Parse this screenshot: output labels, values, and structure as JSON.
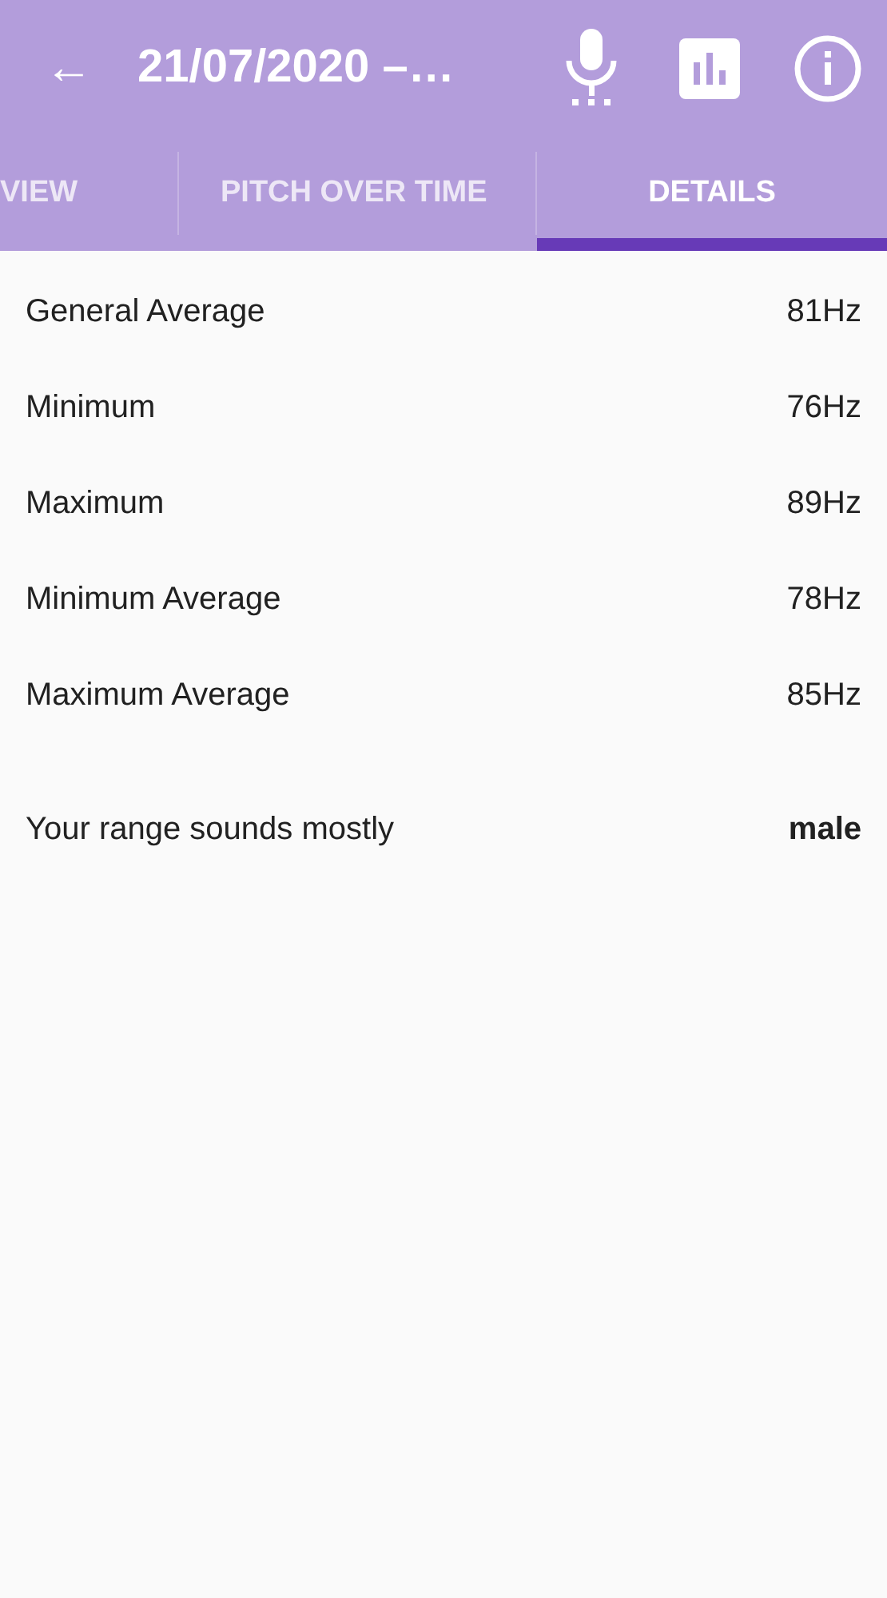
{
  "toolbar": {
    "back": "←",
    "title": "21/07/2020 –…"
  },
  "tabs": [
    {
      "label": "VIEW",
      "selected": false
    },
    {
      "label": "PITCH OVER TIME",
      "selected": false
    },
    {
      "label": "DETAILS",
      "selected": true
    }
  ],
  "stats": [
    {
      "label": "General Average",
      "value": "81Hz"
    },
    {
      "label": "Minimum",
      "value": "76Hz"
    },
    {
      "label": "Maximum",
      "value": "89Hz"
    },
    {
      "label": "Minimum Average",
      "value": "78Hz"
    },
    {
      "label": "Maximum Average",
      "value": "85Hz"
    }
  ],
  "summary": {
    "label": "Your range sounds mostly",
    "value": "male"
  }
}
